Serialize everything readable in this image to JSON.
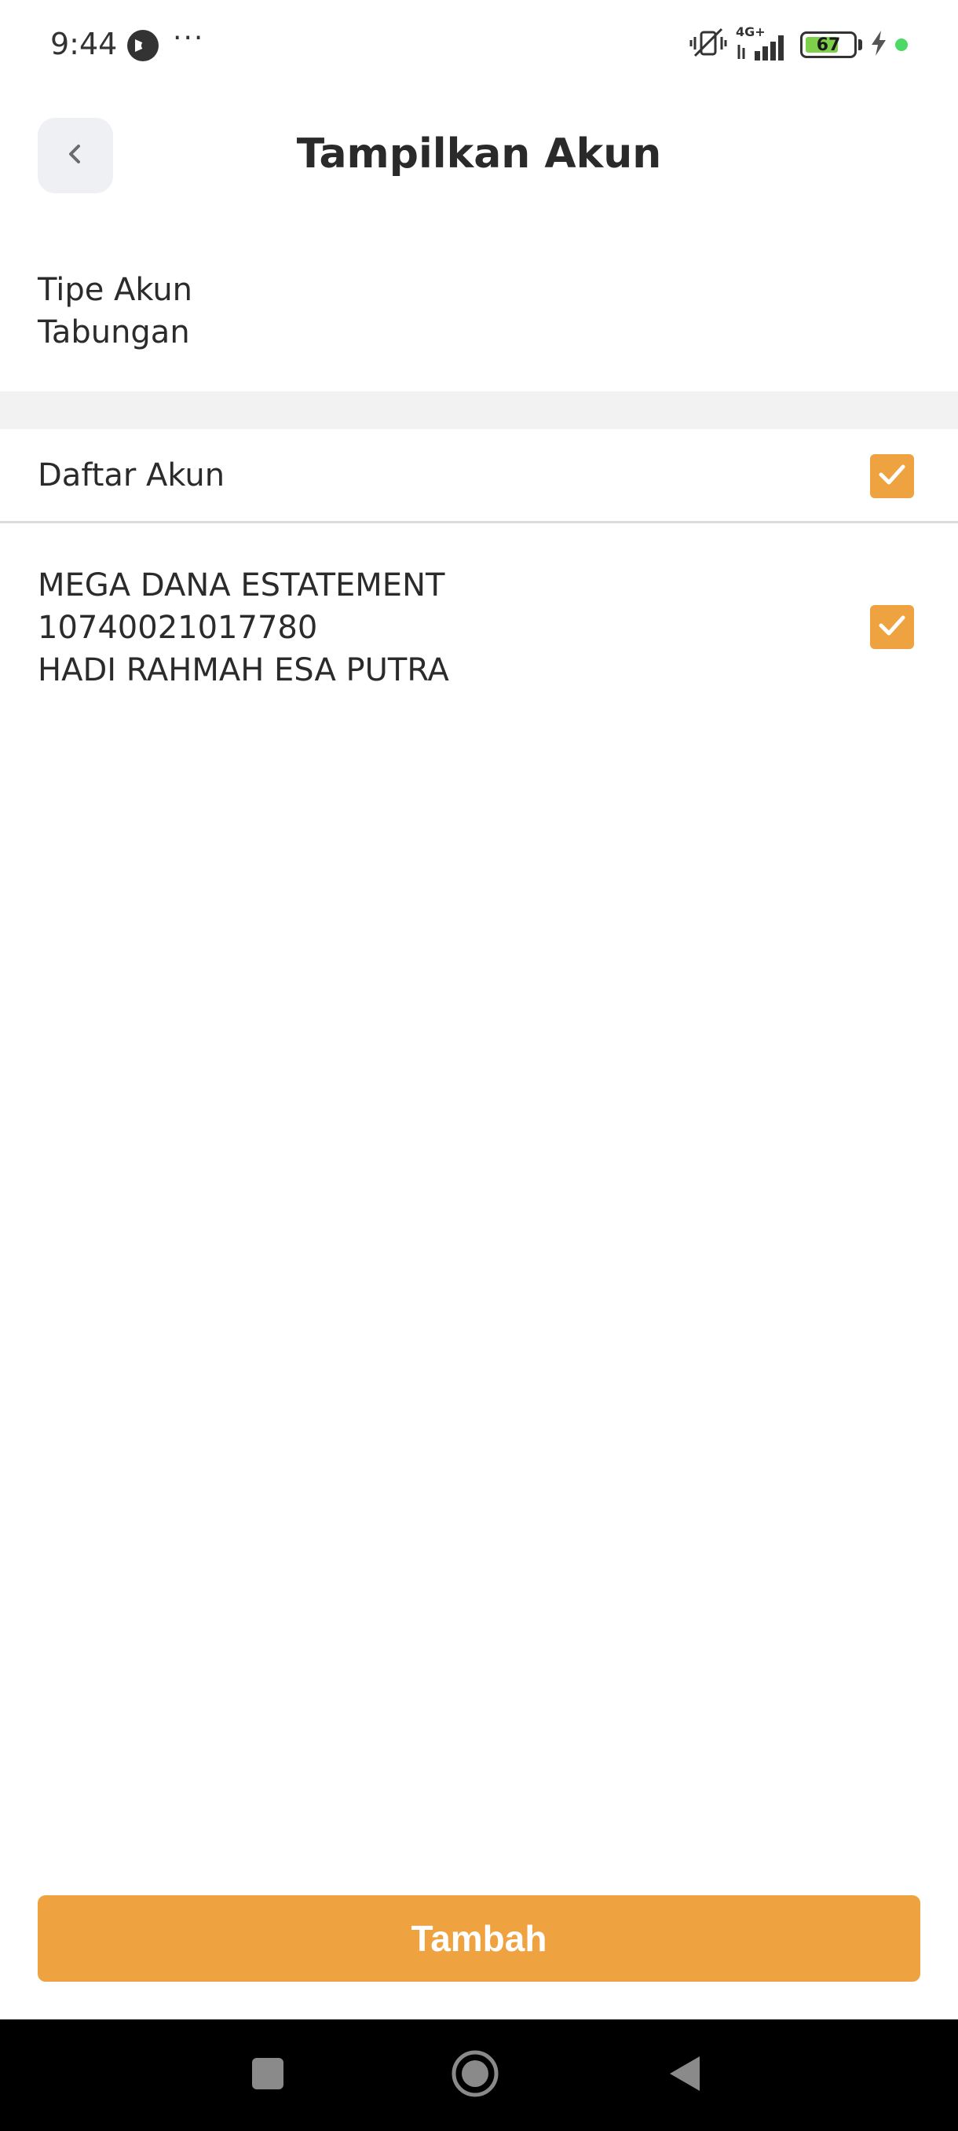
{
  "status_bar": {
    "time": "9:44",
    "more": "···",
    "network": "4G+",
    "battery_level": "67",
    "icons": [
      "app-logo-icon",
      "vibrate-mute-icon",
      "signal-icon",
      "battery-icon",
      "charging-icon",
      "active-dot-icon"
    ]
  },
  "header": {
    "title": "Tampilkan Akun",
    "back_icon": "chevron-left-icon"
  },
  "account_type": {
    "label": "Tipe Akun",
    "value": "Tabungan"
  },
  "account_list": {
    "header_label": "Daftar Akun",
    "header_checked": true,
    "items": [
      {
        "product": "MEGA DANA ESTATEMENT",
        "number": "10740021017780",
        "holder": "HADI RAHMAH ESA PUTRA",
        "checked": true
      }
    ]
  },
  "actions": {
    "add_label": "Tambah"
  },
  "colors": {
    "accent": "#EEA240",
    "back_button_bg": "#EEF0F3",
    "section_gap": "#F2F2F2",
    "nav_bar": "#000000"
  },
  "nav_bar": {
    "icons": [
      "recents-square-icon",
      "home-circle-icon",
      "back-triangle-icon"
    ]
  }
}
